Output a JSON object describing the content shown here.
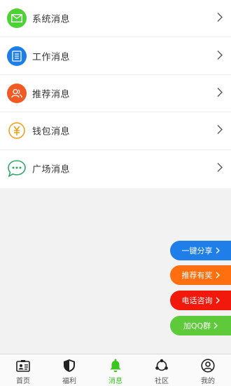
{
  "messages": [
    {
      "label": "系统消息",
      "icon": "mail-icon",
      "color": "#4cd137"
    },
    {
      "label": "工作消息",
      "icon": "document-icon",
      "color": "#1e7ee6"
    },
    {
      "label": "推荐消息",
      "icon": "users-icon",
      "color": "#f15a24"
    },
    {
      "label": "钱包消息",
      "icon": "yuan-coin-icon",
      "color": "#f39c12"
    },
    {
      "label": "广场消息",
      "icon": "chat-bubble-icon",
      "color": "#2fa866"
    }
  ],
  "floating_buttons": [
    {
      "label": "一键分享",
      "color": "#1f7ee8"
    },
    {
      "label": "推荐有奖",
      "color": "#ff6f10"
    },
    {
      "label": "电话咨询",
      "color": "#f0190c"
    },
    {
      "label": "加QQ群",
      "color": "#5ec93a"
    }
  ],
  "tabbar": [
    {
      "label": "首页",
      "icon": "id-card-icon"
    },
    {
      "label": "福利",
      "icon": "shield-icon"
    },
    {
      "label": "消息",
      "icon": "bell-icon",
      "active": true
    },
    {
      "label": "社区",
      "icon": "community-icon"
    },
    {
      "label": "我的",
      "icon": "user-icon"
    }
  ],
  "colors": {
    "active_tab": "#3cc51f",
    "arrow": "#555555"
  }
}
